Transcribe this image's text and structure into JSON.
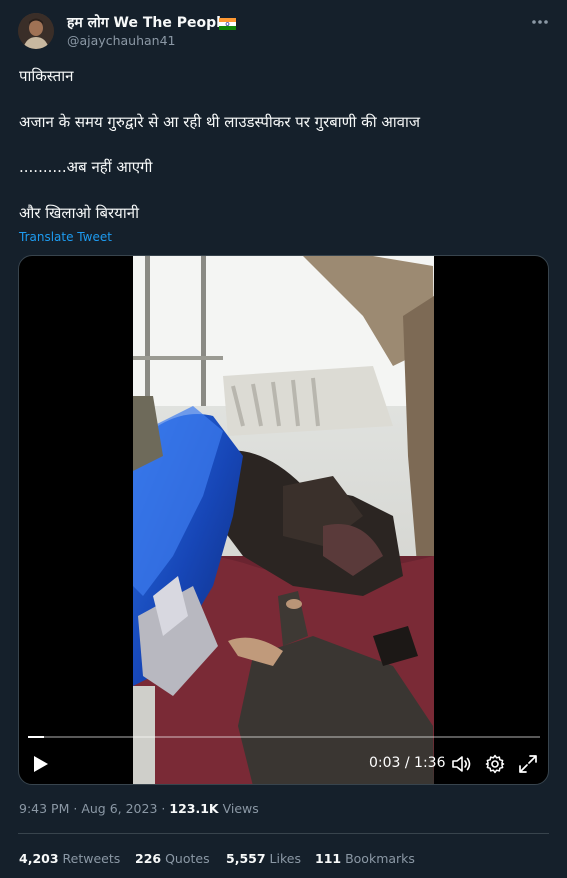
{
  "author": {
    "display_name": "हम लोग We The People",
    "handle": "@ajaychauhan41"
  },
  "tweet": {
    "lines": [
      "पाकिस्तान",
      "अजान के समय गुरुद्वारे से आ रही थी लाउडस्पीकर पर गुरबाणी की आवाज",
      "..........अब नहीं आएगी",
      "और खिलाओ बिरयानी"
    ],
    "translate_label": "Translate Tweet"
  },
  "video": {
    "time_display": "0:03 / 1:36",
    "progress_fraction": 0.031
  },
  "meta": {
    "time": "9:43 PM",
    "separator": "·",
    "date": "Aug 6, 2023",
    "views_count": "123.1K",
    "views_label": "Views"
  },
  "stats": {
    "retweets_count": "4,203",
    "retweets_label": "Retweets",
    "quotes_count": "226",
    "quotes_label": "Quotes",
    "likes_count": "5,557",
    "likes_label": "Likes",
    "bookmarks_count": "111",
    "bookmarks_label": "Bookmarks"
  },
  "colors": {
    "background": "#15202b",
    "primary_text": "#f7f9f9",
    "secondary_text": "#8b98a5",
    "link": "#1d9bf0",
    "divider": "#38444d"
  },
  "icons": [
    "more-icon",
    "flag-india-icon",
    "play-icon",
    "volume-icon",
    "settings-icon",
    "fullscreen-icon"
  ]
}
